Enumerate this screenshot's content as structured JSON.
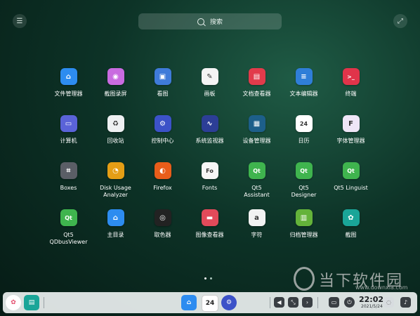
{
  "search": {
    "placeholder": "搜索"
  },
  "top": {
    "menu_icon": "list-icon",
    "expand_icon": "expand-icon"
  },
  "apps": [
    {
      "label": "文件管理器",
      "icon": "folder-icon",
      "color": "#2d8cf0",
      "glyph": "⌂"
    },
    {
      "label": "截图录屏",
      "icon": "camera-icon",
      "color": "#c96be0",
      "glyph": "◉"
    },
    {
      "label": "看图",
      "icon": "image-viewer-icon",
      "color": "#3f7bd9",
      "glyph": "▣"
    },
    {
      "label": "画板",
      "icon": "draw-icon",
      "color": "#f4f4f4",
      "glyph": "✎"
    },
    {
      "label": "文档查看器",
      "icon": "document-viewer-icon",
      "color": "#e23b4b",
      "glyph": "▤"
    },
    {
      "label": "文本编辑器",
      "icon": "text-editor-icon",
      "color": "#2f7ed8",
      "glyph": "≡"
    },
    {
      "label": "终端",
      "icon": "terminal-icon",
      "color": "#e0344a",
      "glyph": ">_"
    },
    {
      "label": "计算机",
      "icon": "computer-icon",
      "color": "#5a63d8",
      "glyph": "▭"
    },
    {
      "label": "回收站",
      "icon": "trash-icon",
      "color": "#eef0f2",
      "glyph": "♻"
    },
    {
      "label": "控制中心",
      "icon": "settings-icon",
      "color": "#3c52c8",
      "glyph": "⚙"
    },
    {
      "label": "系统监视器",
      "icon": "system-monitor-icon",
      "color": "#2c3e96",
      "glyph": "∿"
    },
    {
      "label": "设备管理器",
      "icon": "device-manager-icon",
      "color": "#1d5f8a",
      "glyph": "▦"
    },
    {
      "label": "日历",
      "icon": "calendar-icon",
      "color": "#ffffff",
      "glyph": "24"
    },
    {
      "label": "字体管理器",
      "icon": "font-manager-icon",
      "color": "#efe6f7",
      "glyph": "F"
    },
    {
      "label": "Boxes",
      "icon": "boxes-icon",
      "color": "#5a5e66",
      "glyph": "⌗"
    },
    {
      "label": "Disk Usage\nAnalyzer",
      "icon": "disk-usage-icon",
      "color": "#e59e15",
      "glyph": "◔"
    },
    {
      "label": "Firefox",
      "icon": "firefox-icon",
      "color": "#e85d1a",
      "glyph": "◐"
    },
    {
      "label": "Fonts",
      "icon": "fonts-icon",
      "color": "#f6f6f6",
      "glyph": "Fo"
    },
    {
      "label": "Qt5\nAssistant",
      "icon": "qt-assistant-icon",
      "color": "#3fb44e",
      "glyph": "Qt"
    },
    {
      "label": "Qt5\nDesigner",
      "icon": "qt-designer-icon",
      "color": "#3fb44e",
      "glyph": "Qt"
    },
    {
      "label": "Qt5 Linguist",
      "icon": "qt-linguist-icon",
      "color": "#3fb44e",
      "glyph": "Qt"
    },
    {
      "label": "Qt5\nQDbusViewer",
      "icon": "qdbusviewer-icon",
      "color": "#3fb44e",
      "glyph": "Qt"
    },
    {
      "label": "主目录",
      "icon": "home-folder-icon",
      "color": "#2d8cf0",
      "glyph": "⌂"
    },
    {
      "label": "取色器",
      "icon": "color-picker-icon",
      "color": "#222222",
      "glyph": "◎"
    },
    {
      "label": "图像查看器",
      "icon": "image-viewer-icon",
      "color": "#e24a5a",
      "glyph": "▬"
    },
    {
      "label": "字符",
      "icon": "characters-icon",
      "color": "#f2f2f2",
      "glyph": "a"
    },
    {
      "label": "归档管理器",
      "icon": "archive-manager-icon",
      "color": "#64b33a",
      "glyph": "▥"
    },
    {
      "label": "截图",
      "icon": "screenshot-icon",
      "color": "#1aa598",
      "glyph": "✿"
    }
  ],
  "pager": {
    "pages": 2,
    "active": 1
  },
  "watermark": {
    "text": "当下软件园",
    "url": "www.downxia.com"
  },
  "dock": {
    "launcher_icon": "launcher-icon",
    "multitask_icon": "multitask-icon",
    "pinned": [
      {
        "name": "file-manager-icon",
        "color": "#2d8cf0",
        "glyph": "⌂"
      },
      {
        "name": "calendar-icon",
        "color": "#ffffff",
        "glyph": "24"
      },
      {
        "name": "settings-icon",
        "color": "#3c52c8",
        "glyph": "⚙"
      }
    ],
    "time": "22:02",
    "date": "2021/5/24"
  }
}
